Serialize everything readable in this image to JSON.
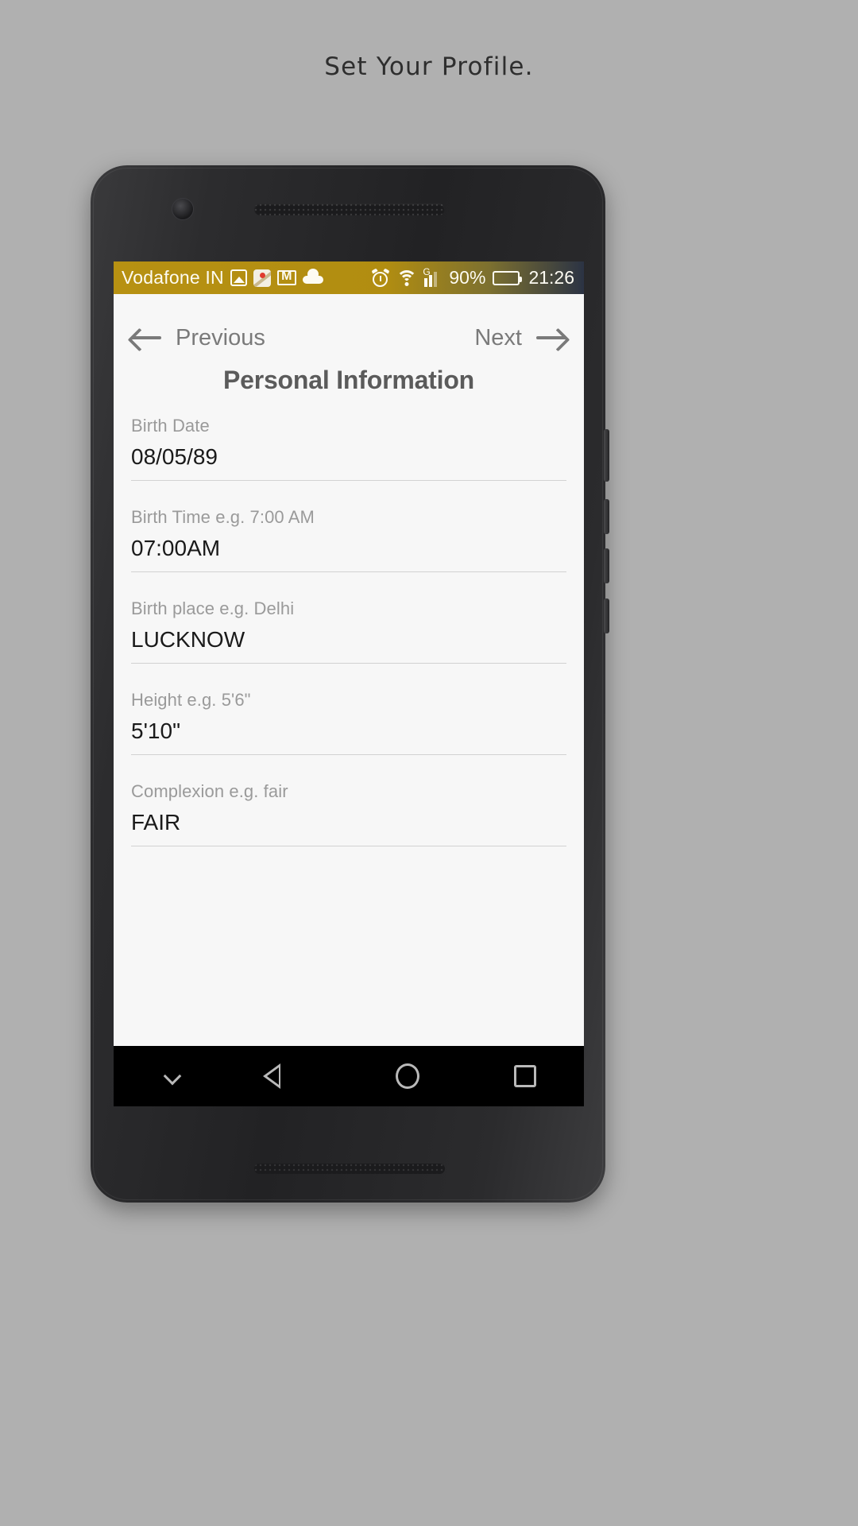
{
  "caption": "Set Your Profile.",
  "status_bar": {
    "carrier": "Vodafone IN",
    "icons": [
      "photos-icon",
      "maps-icon",
      "gmail-icon",
      "cloud-icon"
    ],
    "alarm_icon": "alarm-icon",
    "wifi_icon": "wifi-icon",
    "signal_icon": "signal-bars-icon",
    "network_type": "G",
    "battery_percent": "90%",
    "battery_icon": "battery-icon",
    "time": "21:26",
    "background_color": "#b79112"
  },
  "header": {
    "previous_label": "Previous",
    "next_label": "Next",
    "title": "Personal Information"
  },
  "form": {
    "fields": [
      {
        "label": "Birth Date",
        "value": "08/05/89"
      },
      {
        "label": "Birth Time e.g. 7:00 AM",
        "value": "07:00AM"
      },
      {
        "label": "Birth place e.g. Delhi",
        "value": "LUCKNOW"
      },
      {
        "label": "Height e.g. 5'6\"",
        "value": "5'10\""
      },
      {
        "label": "Complexion e.g. fair",
        "value": "FAIR"
      }
    ]
  },
  "android_nav": {
    "hide_keyboard": "chevron-down-icon",
    "back": "back-triangle-icon",
    "home": "home-circle-icon",
    "recents": "recents-square-icon"
  }
}
